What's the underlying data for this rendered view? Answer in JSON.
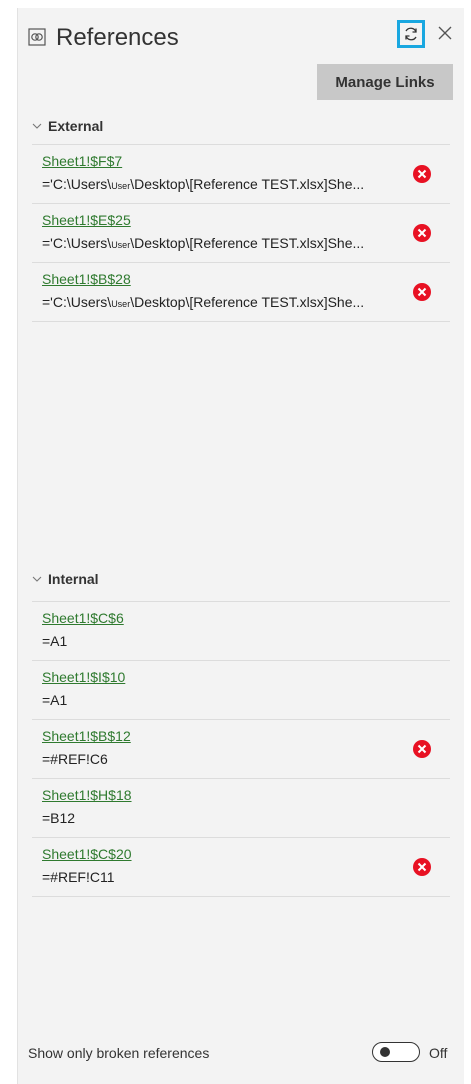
{
  "panel": {
    "title": "References",
    "manage_links_label": "Manage Links"
  },
  "external": {
    "label": "External",
    "items": [
      {
        "ref": "Sheet1!$F$7",
        "formula_pre": "='C:\\Users\\",
        "formula_user": "User",
        "formula_post": "\\Desktop\\[Reference TEST.xlsx]She...",
        "broken": true
      },
      {
        "ref": "Sheet1!$E$25",
        "formula_pre": "='C:\\Users\\",
        "formula_user": "User",
        "formula_post": "\\Desktop\\[Reference TEST.xlsx]She...",
        "broken": true
      },
      {
        "ref": "Sheet1!$B$28",
        "formula_pre": "='C:\\Users\\",
        "formula_user": "User",
        "formula_post": "\\Desktop\\[Reference TEST.xlsx]She...",
        "broken": true
      }
    ]
  },
  "internal": {
    "label": "Internal",
    "items": [
      {
        "ref": "Sheet1!$C$6",
        "formula": "=A1",
        "broken": false
      },
      {
        "ref": "Sheet1!$I$10",
        "formula": "=A1",
        "broken": false
      },
      {
        "ref": "Sheet1!$B$12",
        "formula": "=#REF!C6",
        "broken": true
      },
      {
        "ref": "Sheet1!$H$18",
        "formula": "=B12",
        "broken": false
      },
      {
        "ref": "Sheet1!$C$20",
        "formula": "=#REF!C11",
        "broken": true
      }
    ]
  },
  "footer": {
    "broken_filter_label": "Show only broken references",
    "toggle_state_label": "Off",
    "toggle_on": false
  },
  "icons": {
    "title": "references-icon",
    "refresh": "refresh-icon",
    "close": "close-icon",
    "chevron": "chevron-down-icon",
    "error": "error-icon"
  },
  "colors": {
    "pane_bg": "#f3f3f3",
    "link": "#2f7a2f",
    "error": "#e81123",
    "focus_border": "#19a7e0",
    "button_bg": "#c8c8c8"
  }
}
